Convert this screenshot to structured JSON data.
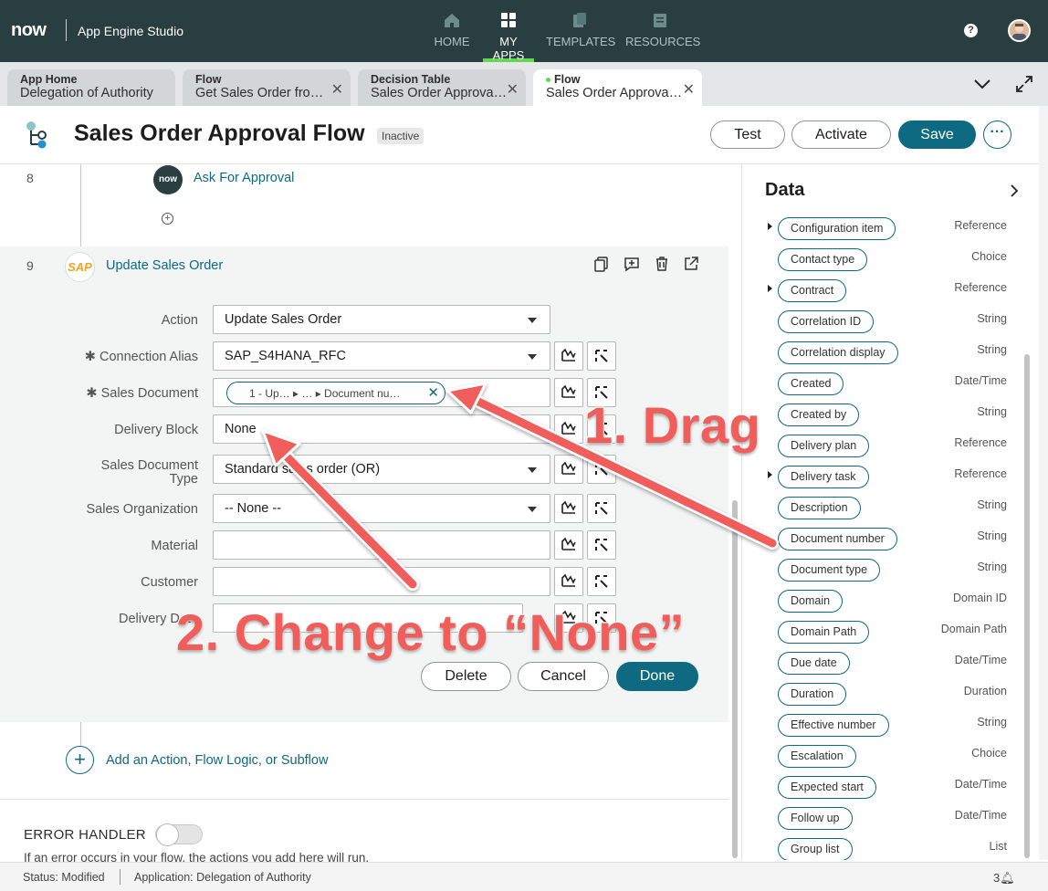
{
  "topbar": {
    "logo": "now",
    "app_title": "App Engine Studio",
    "nav": [
      {
        "label": "HOME",
        "icon": "home-icon"
      },
      {
        "label": "MY APPS",
        "icon": "grid-icon"
      },
      {
        "label": "TEMPLATES",
        "icon": "templates-icon"
      },
      {
        "label": "RESOURCES",
        "icon": "resources-icon"
      }
    ],
    "help": "?"
  },
  "tabs": [
    {
      "type": "App Home",
      "name": "Delegation of Authority"
    },
    {
      "type": "Flow",
      "name": "Get Sales Order fro…"
    },
    {
      "type": "Decision Table",
      "name": "Sales Order Approva…"
    },
    {
      "type": "Flow",
      "name": "Sales Order Approva…"
    }
  ],
  "header": {
    "title": "Sales Order Approval Flow",
    "status": "Inactive",
    "test": "Test",
    "activate": "Activate",
    "save": "Save",
    "more": "···"
  },
  "steps": {
    "s8_num": "8",
    "s8_logo": "now",
    "s8_label": "Ask For Approval",
    "s9_num": "9",
    "s9_logo": "SAP",
    "s9_label": "Update Sales Order"
  },
  "form": {
    "action_label": "Action",
    "action_value": "Update Sales Order",
    "conn_label": "✱ Connection Alias",
    "conn_value": "SAP_S4HANA_RFC",
    "salesdoc_label": "✱ Sales Document",
    "salesdoc_pill": "1 - Up…  ▸ …  ▸ Document nu…",
    "delblock_label": "Delivery Block",
    "delblock_value": "None",
    "sdtype_label_1": "Sales Document",
    "sdtype_label_2": "Type",
    "sdtype_value": "Standard sales order (OR)",
    "salesorg_label": "Sales Organization",
    "salesorg_value": "-- None --",
    "material_label": "Material",
    "customer_label": "Customer",
    "deldate_label": "Delivery Date"
  },
  "card_buttons": {
    "delete": "Delete",
    "cancel": "Cancel",
    "done": "Done"
  },
  "add_action": "Add an Action, Flow Logic, or Subflow",
  "error_handler": {
    "title": "ERROR HANDLER",
    "desc": "If an error occurs in your flow, the actions you add here will run."
  },
  "data_panel": {
    "title": "Data",
    "items": [
      {
        "name": "Configuration item",
        "type": "Reference",
        "expandable": true
      },
      {
        "name": "Contact type",
        "type": "Choice",
        "expandable": false
      },
      {
        "name": "Contract",
        "type": "Reference",
        "expandable": true
      },
      {
        "name": "Correlation ID",
        "type": "String",
        "expandable": false
      },
      {
        "name": "Correlation display",
        "type": "String",
        "expandable": false
      },
      {
        "name": "Created",
        "type": "Date/Time",
        "expandable": false
      },
      {
        "name": "Created by",
        "type": "String",
        "expandable": false
      },
      {
        "name": "Delivery plan",
        "type": "Reference",
        "expandable": false
      },
      {
        "name": "Delivery task",
        "type": "Reference",
        "expandable": true
      },
      {
        "name": "Description",
        "type": "String",
        "expandable": false
      },
      {
        "name": "Document number",
        "type": "String",
        "expandable": false
      },
      {
        "name": "Document type",
        "type": "String",
        "expandable": false
      },
      {
        "name": "Domain",
        "type": "Domain ID",
        "expandable": false
      },
      {
        "name": "Domain Path",
        "type": "Domain Path",
        "expandable": false
      },
      {
        "name": "Due date",
        "type": "Date/Time",
        "expandable": false
      },
      {
        "name": "Duration",
        "type": "Duration",
        "expandable": false
      },
      {
        "name": "Effective number",
        "type": "String",
        "expandable": false
      },
      {
        "name": "Escalation",
        "type": "Choice",
        "expandable": false
      },
      {
        "name": "Expected start",
        "type": "Date/Time",
        "expandable": false
      },
      {
        "name": "Follow up",
        "type": "Date/Time",
        "expandable": false
      },
      {
        "name": "Group list",
        "type": "List",
        "expandable": false
      }
    ]
  },
  "statusbar": {
    "status": "Status: Modified",
    "application": "Application: Delegation of Authority",
    "notifications": "3"
  },
  "annotations": {
    "drag": "1. Drag",
    "change": "2. Change to “None”",
    "color": "#f05d5a"
  }
}
